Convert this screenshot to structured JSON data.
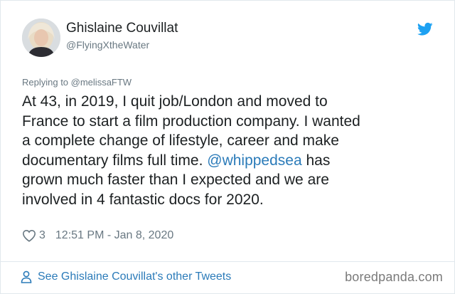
{
  "author": {
    "name": "Ghislaine Couvillat",
    "handle": "@FlyingXtheWater"
  },
  "reply": {
    "prefix": "Replying to ",
    "to": "@melissaFTW"
  },
  "tweet": {
    "line1": "At 43, in 2019, I quit job/London and moved to",
    "line2": "France to start a film production company. I wanted",
    "line3": "a complete change of lifestyle, career and make",
    "line4_pre": "documentary films full time. ",
    "mention": "@whippedsea",
    "line4_post": " has",
    "line5": "grown much faster than I expected and we are",
    "line6": "involved in 4 fantastic docs for 2020."
  },
  "meta": {
    "likes": "3",
    "timestamp": "12:51 PM - Jan 8, 2020"
  },
  "footer": {
    "link": "See Ghislaine Couvillat's other Tweets",
    "watermark": "boredpanda.com"
  },
  "colors": {
    "link": "#2b7bb9",
    "twitter_blue": "#1da1f2",
    "muted": "#697882"
  },
  "icons": [
    "twitter-bird-icon",
    "heart-icon",
    "person-icon"
  ]
}
